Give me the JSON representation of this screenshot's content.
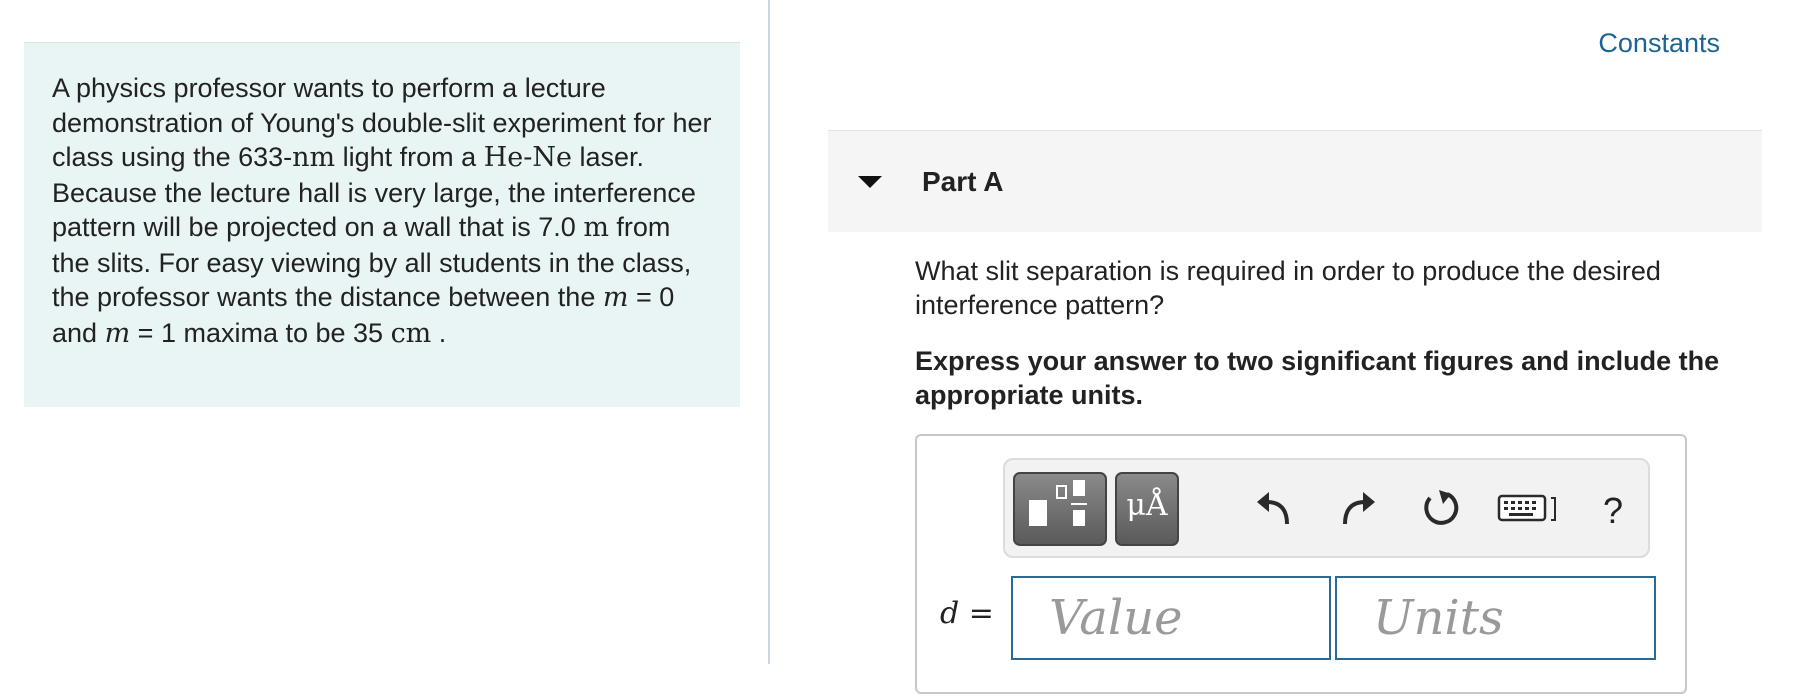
{
  "problem": {
    "segments": [
      {
        "text": "A physics professor wants to perform a lecture demonstration of Young's double-slit experiment for her class using the 633-",
        "style": "text"
      },
      {
        "text": "nm",
        "style": "math"
      },
      {
        "text": " light from a ",
        "style": "text"
      },
      {
        "text": "He-Ne",
        "style": "math"
      },
      {
        "text": " laser. Because the lecture hall is very large, the interference pattern will be projected on a wall that is 7.0 ",
        "style": "text"
      },
      {
        "text": "m",
        "style": "math"
      },
      {
        "text": " from the slits. For easy viewing by all students in the class, the professor wants the distance between the ",
        "style": "text"
      },
      {
        "text": "m",
        "style": "math-i"
      },
      {
        "text": " = 0 and ",
        "style": "text"
      },
      {
        "text": "m",
        "style": "math-i"
      },
      {
        "text": " = 1 maxima to be 35 ",
        "style": "text"
      },
      {
        "text": "cm",
        "style": "math"
      },
      {
        "text": " .",
        "style": "text"
      }
    ]
  },
  "header": {
    "constants_label": "Constants"
  },
  "part": {
    "title": "Part A"
  },
  "question": {
    "text": "What slit separation is required in order to produce the desired interference pattern?",
    "instruction": "Express your answer to two significant figures and include the appropriate units."
  },
  "toolbar": {
    "units_button_label": "μÅ",
    "help_label": "?",
    "icons": [
      "templates-icon",
      "units-icon",
      "undo-icon",
      "redo-icon",
      "reset-icon",
      "keyboard-icon",
      "help-icon"
    ]
  },
  "answer": {
    "variable_label": "d =",
    "value_placeholder": "Value",
    "units_placeholder": "Units",
    "value": "",
    "units": ""
  },
  "colors": {
    "problem_bg": "#e8f5f4",
    "link": "#1a6496",
    "input_border": "#2a6a96",
    "part_header_bg": "#f5f5f5"
  }
}
